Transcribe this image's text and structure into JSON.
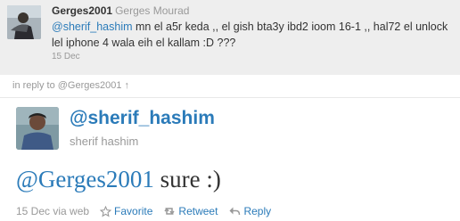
{
  "parent_tweet": {
    "screen_name": "Gerges2001",
    "full_name": "Gerges Mourad",
    "mention": "@sherif_hashim",
    "text": " mn el a5r keda ,, el gish bta3y ibd2 ioom 16-1 ,, hal72 el unlock lel iphone 4 wala eih el kallam :D ???",
    "date": "15 Dec"
  },
  "in_reply": {
    "prefix": "in reply to ",
    "link": "@Gerges2001",
    "arrow": "↑"
  },
  "tweet": {
    "screen_name": "@sherif_hashim",
    "full_name": "sherif hashim",
    "mention": "@Gerges2001",
    "text": " sure :)",
    "timestamp": "15 Dec via web",
    "actions": {
      "favorite": "Favorite",
      "retweet": "Retweet",
      "reply": "Reply"
    }
  },
  "colors": {
    "link": "#2b7bb9",
    "muted": "#999999",
    "text": "#333333",
    "parent_bg": "#eeeeee"
  },
  "icons": [
    "star-icon",
    "retweet-icon",
    "reply-icon",
    "up-arrow-icon"
  ]
}
